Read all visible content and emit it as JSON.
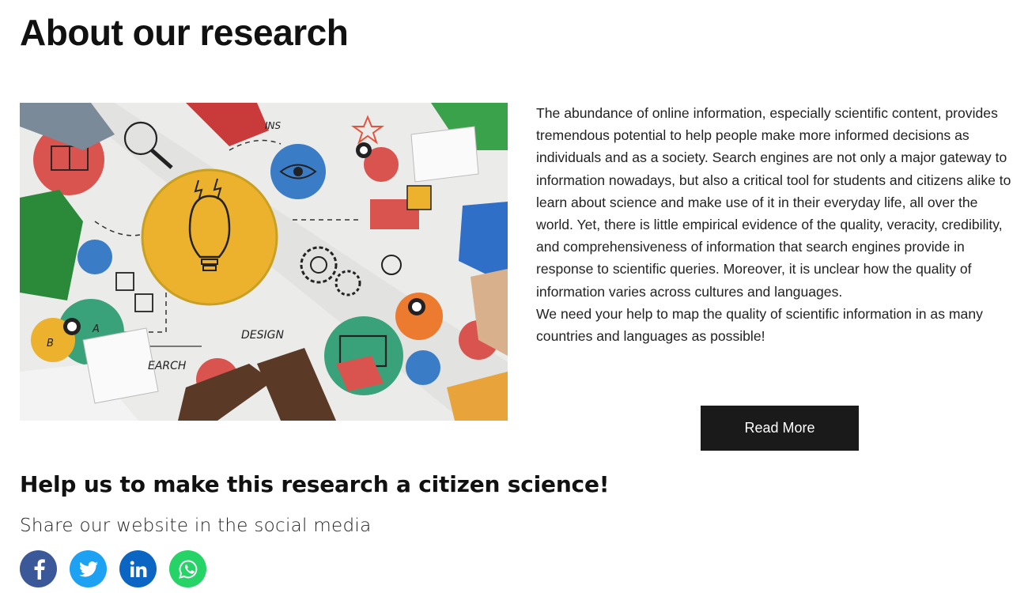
{
  "page": {
    "title": "About our research"
  },
  "about": {
    "paragraph1": "The abundance of online information, especially scientific content, provides tremendous potential to help people make more informed decisions as individuals and as a society. Search engines are not only a major gateway to information nowadays, but also a critical tool for students and citizens alike to learn about science and make use of it in their everyday life, all over the world. Yet, there is little empirical evidence of the quality, veracity, credibility, and comprehensiveness of information that search engines provide in response to scientific queries. Moreover, it is unclear how the quality of information varies across cultures and languages.",
    "paragraph2": "We need your help to map the quality of scientific information in as many countries and languages as possible!",
    "read_more_label": "Read More"
  },
  "hero_image": {
    "labels": {
      "design": "DESIGN",
      "search": "EARCH",
      "ins": "INS",
      "a": "A",
      "b": "B"
    }
  },
  "cta": {
    "heading": "Help us to make this research a citizen science!",
    "share_text": "Share our website in the social media"
  },
  "social": [
    {
      "name": "facebook-icon",
      "color": "#3b5998"
    },
    {
      "name": "twitter-icon",
      "color": "#1da1f2"
    },
    {
      "name": "linkedin-icon",
      "color": "#0a66c2"
    },
    {
      "name": "whatsapp-icon",
      "color": "#25d366"
    }
  ]
}
